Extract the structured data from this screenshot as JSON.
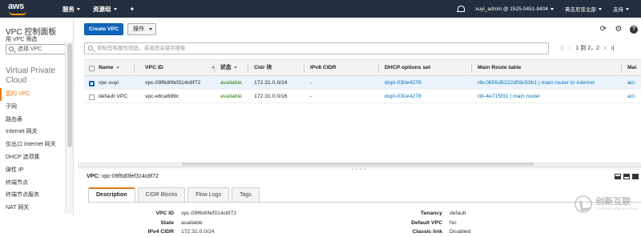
{
  "topbar": {
    "logo": "aws",
    "services": "服务",
    "resource_groups": "资源组",
    "pin_icon": "pin-icon",
    "account": "xuyi_admin @ 1525-0451-8404",
    "region": "弗吉尼亚北部",
    "support": "支持"
  },
  "sidebar": {
    "title": "VPC 控制面板",
    "filter_label": "用 VPC 筛选",
    "filter_placeholder": "选择 VPC",
    "section": "Virtual Private Cloud",
    "items": [
      {
        "label": "您的 VPC",
        "active": true
      },
      {
        "label": "子网"
      },
      {
        "label": "路由表"
      },
      {
        "label": "Internet 网关"
      },
      {
        "label": "仅出口 Internet 网关"
      },
      {
        "label": "DHCP 选项集"
      },
      {
        "label": "弹性 IP"
      },
      {
        "label": "终端节点"
      },
      {
        "label": "终端节点服务"
      },
      {
        "label": "NAT 网关"
      }
    ]
  },
  "toolbar": {
    "create_vpc": "Create VPC",
    "actions": "操作"
  },
  "search": {
    "placeholder": "按标签和属性筛选，或者按关键字搜索"
  },
  "pager": {
    "text": "1 到 2，2"
  },
  "table": {
    "columns": [
      "Name",
      "VPC ID",
      "状态",
      "Cidr 块",
      "IPv6 CIDR",
      "DHCP options set",
      "Main Route table",
      "Mai"
    ],
    "rows": [
      {
        "name": "vpc-xuyi",
        "vpc_id": "vpc-09f6d0fef314c8f72",
        "state": "available",
        "cidr": "172.31.0.0/24",
        "ipv6": "-",
        "dhcp": "dopt-030e4278",
        "route": "rtb-0655d5222d59c53b1 | main router to internet",
        "main": "acl-",
        "selected": true
      },
      {
        "name": "default VPC",
        "vpc_id": "vpc-e6ca699c",
        "state": "available",
        "cidr": "172.31.0.0/16",
        "ipv6": "-",
        "dhcp": "dopt-030e4278",
        "route": "rtb-4e715f31 | main router",
        "main": "acl-",
        "selected": false
      }
    ]
  },
  "details": {
    "label": "VPC:",
    "vpc": "vpc-09f6d0fef314c8f72",
    "tabs": [
      "Description",
      "CIDR Blocks",
      "Flow Logs",
      "Tags"
    ],
    "left": [
      {
        "k": "VPC ID",
        "v": "vpc-09f6d0fef314c8f72"
      },
      {
        "k": "State",
        "v": "available"
      },
      {
        "k": "IPv4 CIDR",
        "v": "172.31.0.0/24"
      }
    ],
    "right": [
      {
        "k": "Tenancy",
        "v": "default"
      },
      {
        "k": "Default VPC",
        "v": "No"
      },
      {
        "k": "Classic link",
        "v": "Disabled"
      }
    ]
  },
  "watermark": {
    "text": "创新互联",
    "sub": "CHUANG XIN HU LIAN"
  },
  "colors": {
    "topbar": "#232f3e",
    "primary": "#1166bb",
    "accent": "#e47911",
    "available": "#1d8102",
    "link": "#0073bb"
  }
}
